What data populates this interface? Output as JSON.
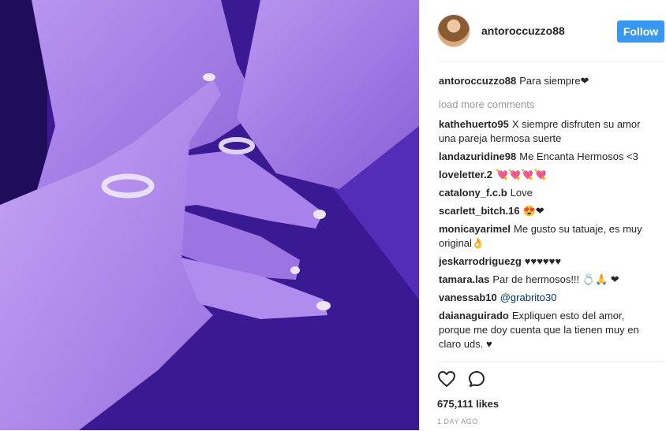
{
  "post": {
    "username": "antoroccuzzo88",
    "follow_label": "Follow",
    "caption": {
      "user": "antoroccuzzo88",
      "text": "Para siempre❤"
    },
    "load_more": "load more comments",
    "comments": [
      {
        "user": "kathehuerto95",
        "text": "X siempre disfruten su amor una pareja hermosa suerte"
      },
      {
        "user": "landazuridine98",
        "text": "Me Encanta Hermosos <3"
      },
      {
        "user": "loveletter.2",
        "text": "💘💘💘💘"
      },
      {
        "user": "catalony_f.c.b",
        "text": "Love"
      },
      {
        "user": "scarlett_bitch.16",
        "text": "😍❤"
      },
      {
        "user": "monicayarimel",
        "text": "Me gusto su tatuaje, es muy original👌"
      },
      {
        "user": "jeskarrodriguezg",
        "text": "♥♥♥♥♥♥"
      },
      {
        "user": "tamara.las",
        "text": "Par de hermosos!!! 💍🙏 ❤"
      },
      {
        "user": "vanessab10",
        "mention": "@grabrito30",
        "text": ""
      },
      {
        "user": "daianaguirado",
        "text": "Expliquen esto del amor, porque me doy cuenta que la tienen muy en claro uds. ♥"
      }
    ],
    "likes": "675,111 likes",
    "time": "1 DAY AGO",
    "icons": {
      "like": "heart-outline-icon",
      "comment": "comment-bubble-icon"
    },
    "colors": {
      "accent": "#3897f0",
      "photo_tint": "#4a22b8"
    }
  }
}
